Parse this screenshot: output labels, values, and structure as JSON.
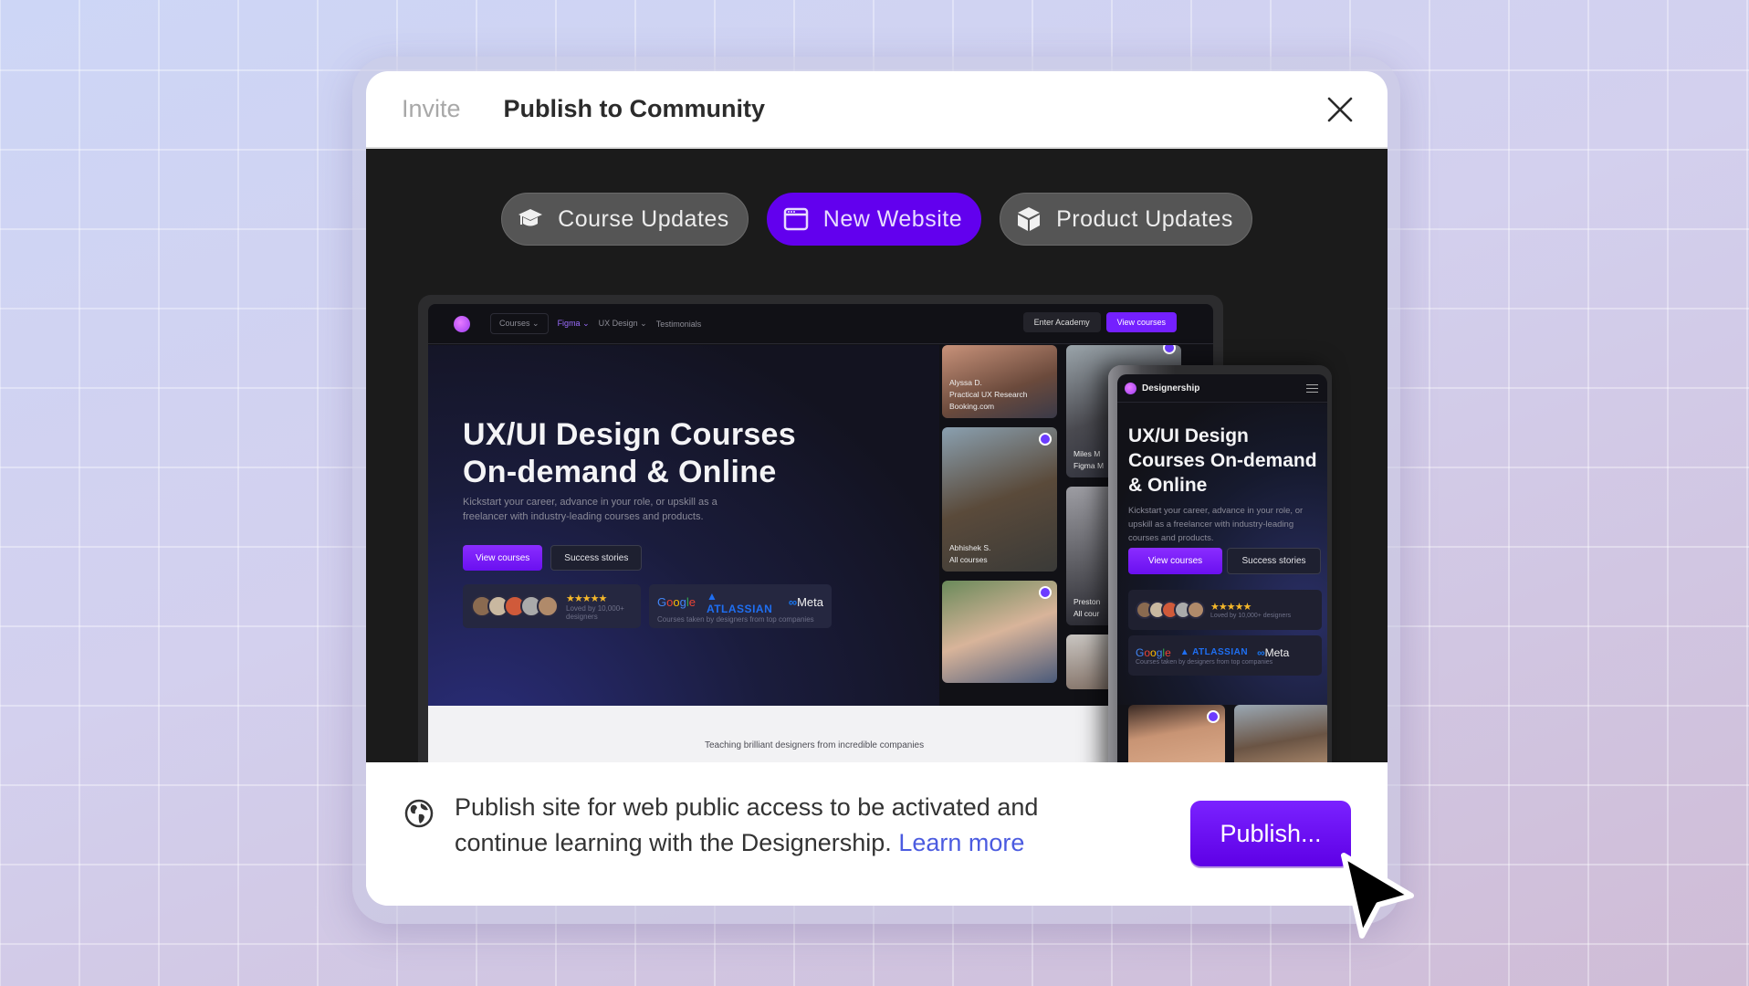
{
  "dialog": {
    "tabs": [
      {
        "label": "Invite",
        "active": false
      },
      {
        "label": "Publish to Community",
        "active": true
      }
    ],
    "close_icon": "close-icon"
  },
  "categories": [
    {
      "label": "Course Updates",
      "icon": "graduation-cap-icon",
      "active": false
    },
    {
      "label": "New Website",
      "icon": "browser-window-icon",
      "active": true
    },
    {
      "label": "Product Updates",
      "icon": "box-icon",
      "active": false
    }
  ],
  "preview": {
    "desktop": {
      "nav": {
        "items": [
          "Courses",
          "Figma",
          "UX Design",
          "Testimonials"
        ],
        "enter_academy": "Enter Academy",
        "view_courses": "View courses"
      },
      "hero": {
        "title_line1": "UX/UI Design Courses",
        "title_line2": "On-demand & Online",
        "subtitle": "Kickstart your career, advance in your role, or upskill as a freelancer with industry-leading courses and products.",
        "primary_cta": "View courses",
        "secondary_cta": "Success stories",
        "rating_stars": "★★★★★",
        "rating_text": "Loved by 10,000+ designers",
        "logos": {
          "google": "Google",
          "atlassian": "ATLASSIAN",
          "meta": "Meta"
        },
        "logos_caption": "Courses taken by designers from top companies"
      },
      "testimonials": [
        {
          "name": "Alyssa D.",
          "course": "Practical UX Research",
          "company": "Booking.com"
        },
        {
          "name": "Abhishek S.",
          "course": "All courses"
        },
        {
          "name": "Miles M",
          "course": "Figma M"
        },
        {
          "name": "Preston",
          "course": "All cour"
        }
      ],
      "footer_text": "Teaching brilliant designers from incredible companies"
    },
    "mobile": {
      "brand": "Designership",
      "title": "UX/UI Design Courses On-demand & Online",
      "subtitle": "Kickstart your career, advance in your role, or upskill as a freelancer with industry-leading courses and products.",
      "primary_cta": "View courses",
      "secondary_cta": "Success stories",
      "rating_stars": "★★★★★",
      "rating_text": "Loved by 10,000+ designers",
      "logos_caption": "Courses taken by designers from top companies"
    }
  },
  "footer": {
    "message": "Publish site for web public access to be activated and continue learning with the Designership.",
    "learn_more": "Learn more",
    "publish_button": "Publish..."
  },
  "colors": {
    "accent": "#6200EE",
    "link": "#4B5BE0"
  }
}
